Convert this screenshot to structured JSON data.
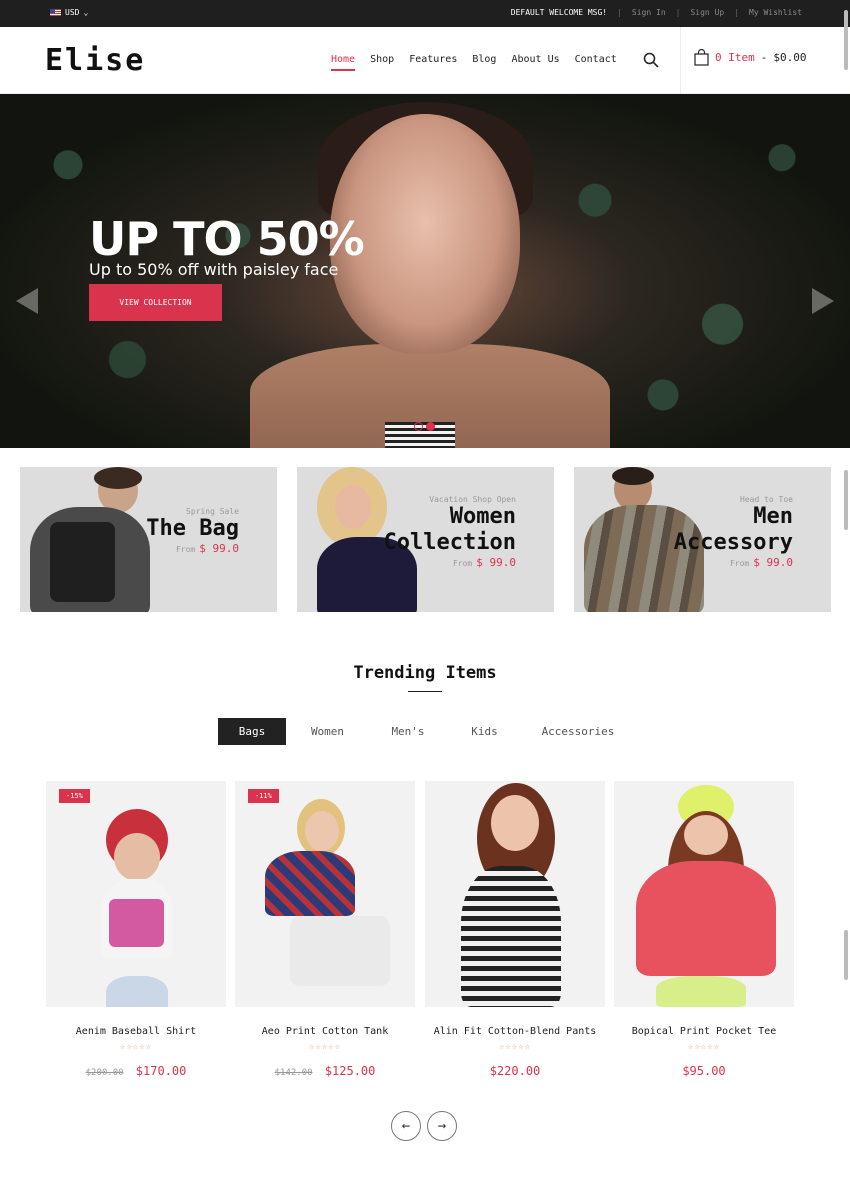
{
  "topbar": {
    "currency": "USD",
    "welcome": "DEFAULT WELCOME MSG!",
    "sign_in": "Sign In",
    "sign_up": "Sign Up",
    "wishlist": "My Wishlist"
  },
  "header": {
    "logo": "Elise",
    "nav": [
      "Home",
      "Shop",
      "Features",
      "Blog",
      "About Us",
      "Contact"
    ],
    "cart_count": "0 Item",
    "cart_total": "$0.00"
  },
  "hero": {
    "title": "UP TO 50%",
    "subtitle": "Up to 50% off with paisley face",
    "button": "VIEW COLLECTION"
  },
  "banners": [
    {
      "small": "Spring Sale",
      "title_lines": [
        "The Bag"
      ],
      "from": "From",
      "price": "$ 99.0"
    },
    {
      "small": "Vacation Shop Open",
      "title_lines": [
        "Women",
        "Collection"
      ],
      "from": "From",
      "price": "$ 99.0"
    },
    {
      "small": "Head to Toe",
      "title_lines": [
        "Men",
        "Accessory"
      ],
      "from": "From",
      "price": "$ 99.0"
    }
  ],
  "trending": {
    "title": "Trending Items",
    "tabs": [
      "Bags",
      "Women",
      "Men's",
      "Kids",
      "Accessories"
    ],
    "active_tab": "Bags"
  },
  "products": [
    {
      "name": "Aenim Baseball Shirt",
      "badge": "-15%",
      "old_price": "$200.00",
      "price": "$170.00",
      "stars": "☆☆☆☆☆"
    },
    {
      "name": "Aeo Print Cotton Tank",
      "badge": "-11%",
      "old_price": "$142.00",
      "price": "$125.00",
      "stars": "☆☆☆☆☆"
    },
    {
      "name": "Alin Fit Cotton-Blend Pants",
      "badge": "",
      "old_price": "",
      "price": "$220.00",
      "stars": "☆☆☆☆☆"
    },
    {
      "name": "Bopical Print Pocket Tee",
      "badge": "",
      "old_price": "",
      "price": "$95.00",
      "stars": "☆☆☆☆☆"
    }
  ],
  "pager": {
    "prev": "←",
    "next": "→"
  },
  "colors": {
    "accent": "#d9334d",
    "dark": "#1f1f1f"
  }
}
